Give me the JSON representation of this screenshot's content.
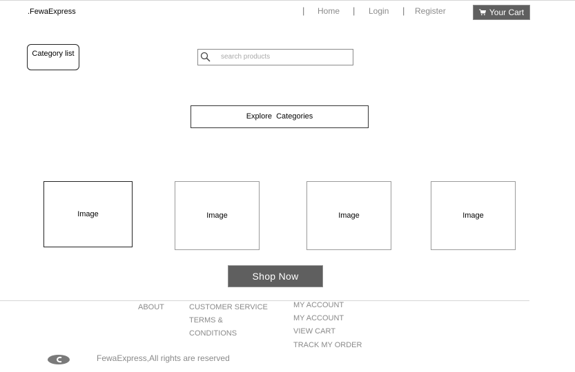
{
  "header": {
    "brand": ".FewaExpress",
    "nav": {
      "separator": "|",
      "home": "Home",
      "login": "Login",
      "register": "Register"
    },
    "cart_label": "Your Cart"
  },
  "sidebar": {
    "category_list_label": "Category list"
  },
  "search": {
    "placeholder": "search products"
  },
  "main": {
    "explore_label": "Explore  Categories",
    "images": [
      "Image",
      "Image",
      "Image",
      "Image"
    ],
    "shop_now_label": "Shop Now"
  },
  "footer": {
    "about": "ABOUT",
    "customer_service": "CUSTOMER SERVICE",
    "terms": "TERMS &",
    "conditions": "CONDITIONS",
    "account_links": [
      "MY ACCOUNT",
      "MY ACCOUNT",
      "VIEW CART",
      "TRACK MY ORDER"
    ],
    "copyright": "FewaExpress,All rights are reserved"
  },
  "colors": {
    "button_bg": "#5f5f5f",
    "link_gray": "#8a8a8a"
  },
  "icons": {
    "cart": "cart-icon",
    "search": "search-icon",
    "copyright": "copyright-logo-icon"
  }
}
